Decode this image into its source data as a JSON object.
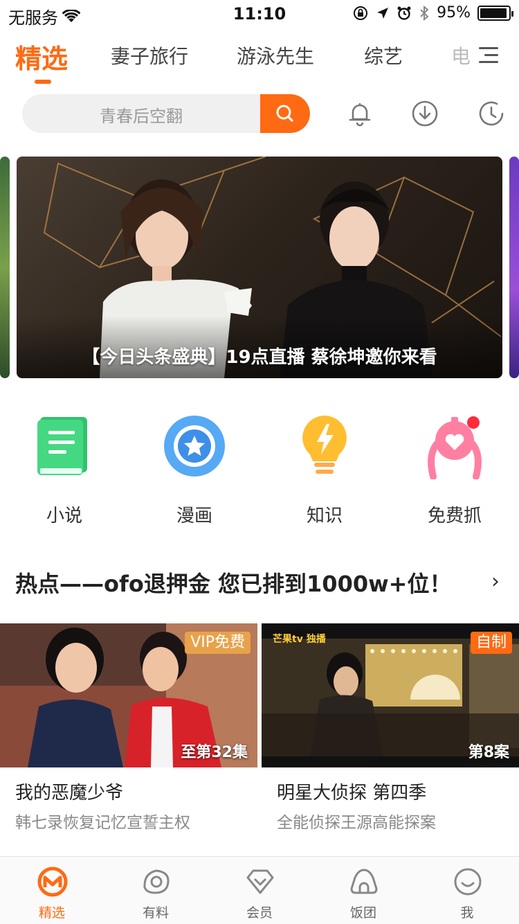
{
  "status_bar": {
    "carrier": "无服务",
    "time": "11:10",
    "battery": "95%",
    "battery_level": 0.95
  },
  "tabs": [
    {
      "label": "精选",
      "active": true
    },
    {
      "label": "妻子旅行",
      "active": false
    },
    {
      "label": "游泳先生",
      "active": false
    },
    {
      "label": "综艺",
      "active": false
    },
    {
      "label": "电",
      "active": false
    }
  ],
  "search": {
    "placeholder": "青春后空翻"
  },
  "banner": {
    "caption": "【今日头条盛典】19点直播 蔡徐坤邀你来看"
  },
  "entries": [
    {
      "label": "小说",
      "icon": "book-icon"
    },
    {
      "label": "漫画",
      "icon": "star-badge-icon"
    },
    {
      "label": "知识",
      "icon": "lightbulb-icon"
    },
    {
      "label": "免费抓",
      "icon": "claw-machine-icon"
    }
  ],
  "hot": {
    "text": "热点——ofo退押金 您已排到1000w+位！",
    "arrow": "›"
  },
  "cards": [
    {
      "badge": "VIP免费",
      "badge_color": "#e8a24a",
      "episode": "至第32集",
      "title": "我的恶魔少爷",
      "subtitle": "韩七录恢复记忆宣誓主权"
    },
    {
      "badge": "自制",
      "badge_color": "#ff6a13",
      "episode": "第8案",
      "title": "明星大侦探 第四季",
      "subtitle": "全能侦探王源高能探案",
      "logo": "芒果tv 独播"
    }
  ],
  "bottom_nav": [
    {
      "label": "精选",
      "active": true
    },
    {
      "label": "有料",
      "active": false
    },
    {
      "label": "会员",
      "active": false
    },
    {
      "label": "饭团",
      "active": false
    },
    {
      "label": "我",
      "active": false
    }
  ],
  "colors": {
    "accent": "#ff6a13"
  }
}
